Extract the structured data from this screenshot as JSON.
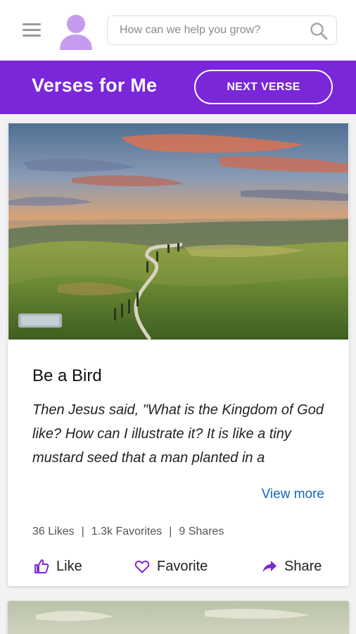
{
  "header": {
    "search_placeholder": "How can we help you grow?"
  },
  "banner": {
    "title": "Verses for Me",
    "next_button_label": "NEXT VERSE"
  },
  "card": {
    "title": "Be a Bird",
    "text": "Then Jesus said, \"What is the Kingdom of God like? How can I illustrate it? It is like a tiny mustard seed that a man planted in a",
    "view_more_label": "View more",
    "stats": {
      "likes": "36 Likes",
      "favorites": "1.3k Favorites",
      "shares": "9 Shares",
      "separator": "|"
    },
    "actions": {
      "like_label": "Like",
      "favorite_label": "Favorite",
      "share_label": "Share"
    }
  },
  "icons": {
    "menu": "hamburger-menu-icon",
    "avatar": "user-avatar-icon",
    "search": "search-icon",
    "like": "thumbs-up-icon",
    "favorite": "heart-icon",
    "share": "share-arrow-icon"
  },
  "colors": {
    "brand_purple": "#7a26d9",
    "avatar_purple": "#c59bf0",
    "link_blue": "#1565c0",
    "feed_background": "#f2f2f4"
  }
}
